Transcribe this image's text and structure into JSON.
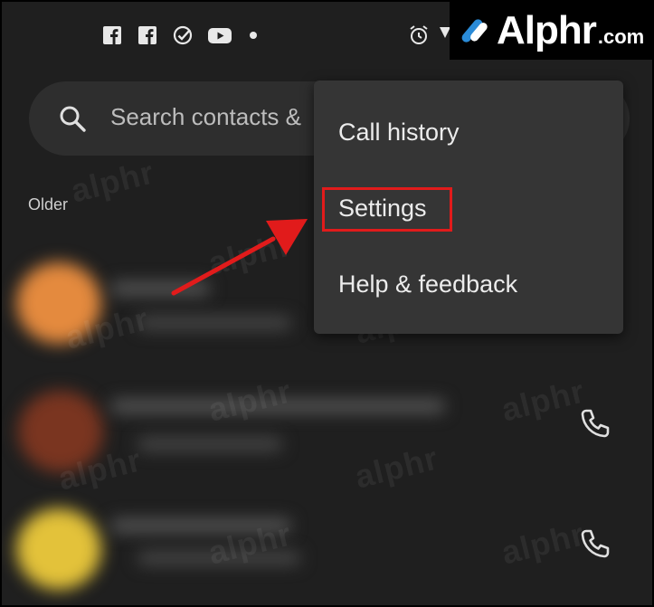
{
  "brand": {
    "name": "Alphr",
    "domain_suffix": ".com",
    "watermark": "alphr"
  },
  "status_bar": {
    "icons": [
      "facebook-icon",
      "facebook-icon",
      "check-circle-icon",
      "youtube-icon",
      "notification-dot-icon",
      "alarm-icon",
      "wifi-icon"
    ]
  },
  "search": {
    "placeholder": "Search contacts &"
  },
  "recents": {
    "section_label": "Older"
  },
  "menu": {
    "items": [
      {
        "label": "Call history"
      },
      {
        "label": "Settings"
      },
      {
        "label": "Help & feedback"
      }
    ],
    "highlighted_index": 1
  },
  "annotation": {
    "highlight_color": "#e11b1b",
    "arrow_color": "#e11b1b"
  },
  "colors": {
    "background": "#1f1f1f",
    "menu_background": "#353535",
    "search_background": "#2e2e2e"
  }
}
